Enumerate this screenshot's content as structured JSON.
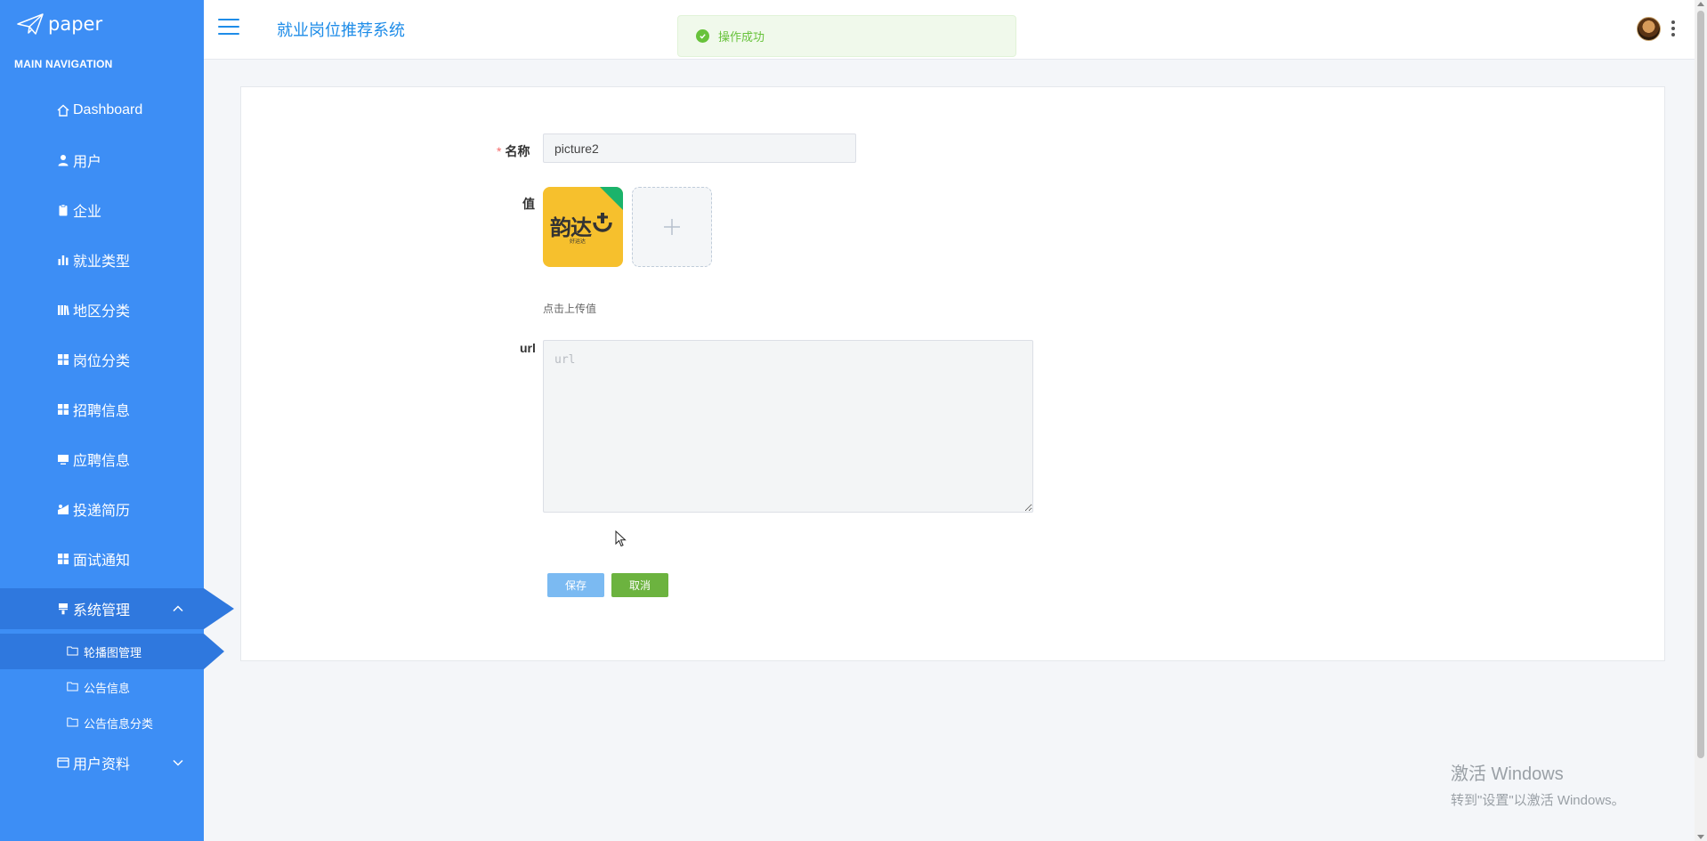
{
  "app": {
    "logo_text": "paper",
    "system_title": "就业岗位推荐系统"
  },
  "colors": {
    "sidebar": "#3d8ef5",
    "sidebar_active": "#2f78de",
    "accent": "#1e8ce8",
    "success": "#67c23a",
    "save_button": "#7bbaf2",
    "cancel_button": "#6cb33f"
  },
  "sidebar": {
    "heading": "MAIN NAVIGATION",
    "items": [
      {
        "label": "Dashboard",
        "icon": "home-icon"
      },
      {
        "label": "用户",
        "icon": "user-icon"
      },
      {
        "label": "企业",
        "icon": "clipboard-icon"
      },
      {
        "label": "就业类型",
        "icon": "bar-chart-icon"
      },
      {
        "label": "地区分类",
        "icon": "library-icon"
      },
      {
        "label": "岗位分类",
        "icon": "grid-icon"
      },
      {
        "label": "招聘信息",
        "icon": "grid-icon"
      },
      {
        "label": "应聘信息",
        "icon": "monitor-icon"
      },
      {
        "label": "投递简历",
        "icon": "send-icon"
      },
      {
        "label": "面试通知",
        "icon": "grid-icon"
      },
      {
        "label": "系统管理",
        "icon": "brush-icon",
        "expanded": true
      }
    ],
    "sub_items": [
      {
        "label": "轮播图管理",
        "icon": "folder-icon",
        "active": true
      },
      {
        "label": "公告信息",
        "icon": "folder-icon"
      },
      {
        "label": "公告信息分类",
        "icon": "folder-icon"
      }
    ],
    "last_item": {
      "label": "用户资料",
      "icon": "id-card-icon"
    }
  },
  "toast": {
    "message": "操作成功"
  },
  "form": {
    "name_label": "名称",
    "name_required_mark": "*",
    "name_value": "picture2",
    "value_label": "值",
    "thumbnail_brand": "韵达",
    "thumbnail_small": "好运达",
    "upload_hint": "点击上传值",
    "url_label": "url",
    "url_placeholder": "url",
    "save_label": "保存",
    "cancel_label": "取消"
  },
  "watermark": {
    "title": "激活 Windows",
    "subtitle": "转到\"设置\"以激活 Windows。"
  }
}
